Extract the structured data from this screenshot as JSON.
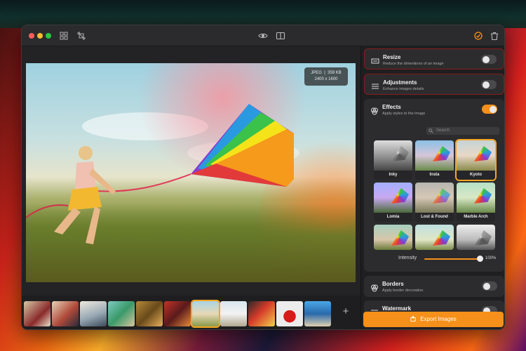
{
  "window": {
    "title": ""
  },
  "photo": {
    "badge_format": "JPEG",
    "badge_size": "359 KB",
    "badge_dims": "2400 x 1600"
  },
  "panel": {
    "resize": {
      "title": "Resize",
      "subtitle": "Reduce the dimentions of an image",
      "enabled": false
    },
    "adjustments": {
      "title": "Adjustments",
      "subtitle": "Enhance images details",
      "enabled": false
    },
    "effects": {
      "title": "Effects",
      "subtitle": "Apply styles to the image",
      "enabled": true,
      "search_placeholder": "Search",
      "items": [
        {
          "label": "Inky"
        },
        {
          "label": "Insta"
        },
        {
          "label": "Kyoto",
          "selected": true
        },
        {
          "label": "Lomia"
        },
        {
          "label": "Lost & Found"
        },
        {
          "label": "Marble Arch"
        },
        {
          "label": ""
        },
        {
          "label": ""
        },
        {
          "label": ""
        }
      ],
      "intensity_label": "Intensity",
      "intensity_value": "100%",
      "intensity_fraction": 0.96
    },
    "borders": {
      "title": "Borders",
      "subtitle": "Apply border decoration",
      "enabled": false
    },
    "watermark": {
      "title": "Watermark"
    },
    "export_label": "Export Images"
  },
  "colors": {
    "accent": "#f5901a",
    "selection": "#f5a623",
    "panel": "#1f1f21",
    "card": "#2c2c2e"
  },
  "filmstrip": {
    "selected_index": 6,
    "count": 11
  }
}
